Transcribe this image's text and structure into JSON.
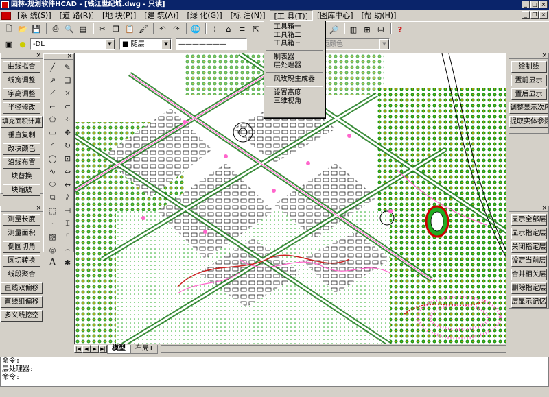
{
  "window": {
    "title": "园林-规划软件HCAD - [钱江世纪城.dwg - 只读]"
  },
  "menu": [
    {
      "label": "[系 统(S)]"
    },
    {
      "label": "[道 路(R)]"
    },
    {
      "label": "[地 块(P)]"
    },
    {
      "label": "[建 筑(A)]"
    },
    {
      "label": "[绿 化(G)]"
    },
    {
      "label": "[标 注(N)]"
    },
    {
      "label": "[工 具(T)]"
    },
    {
      "label": "[图库中心]"
    },
    {
      "label": "[帮 助(H)]"
    }
  ],
  "active_menu_index": 6,
  "dropdown": {
    "group1": [
      "工具箱一",
      "工具箱二",
      "工具箱三"
    ],
    "group2": [
      "制表器",
      "层处理器"
    ],
    "group3": [
      "风玫瑰生成器"
    ],
    "group4": [
      "设置高度",
      "三维视角"
    ]
  },
  "toolbar1": {
    "icons": [
      "new-icon",
      "open-icon",
      "save-icon",
      "print-icon",
      "print-preview-icon",
      "cut-icon",
      "copy-icon",
      "paste-icon",
      "match-prop-icon",
      "undo-icon",
      "redo-icon",
      "web-icon",
      "snap-icon",
      "ucs-icon",
      "layer-icon",
      "pick-icon",
      "grid-icon"
    ],
    "right_icons": [
      "zoom-window-icon",
      "properties-icon",
      "table-icon",
      "database-icon",
      "help-icon"
    ]
  },
  "toolbar2": {
    "layer_value": "-DL",
    "color_value": "■ 随层",
    "linetype_value": "——————— CONTINUOUS",
    "plotstyle_value": "随颜色"
  },
  "left_panel_top": {
    "buttons": [
      "曲线拟合",
      "线宽调整",
      "字高调整",
      "半径修改",
      "填充面积计算",
      "垂直复制",
      "改块颜色",
      "沿线布置",
      "块替换",
      "块缩放"
    ]
  },
  "left_panel_bottom": {
    "buttons": [
      "测量长度",
      "测量面积",
      "倒圆切角",
      "圆切转换",
      "线段聚合",
      "直线双偏移",
      "直线组偏移",
      "多义线挖空"
    ]
  },
  "right_panel_top": {
    "buttons": [
      "绘制线",
      "置前显示",
      "置后显示",
      "调整显示次序",
      "提取实体参数"
    ]
  },
  "right_panel_bottom": {
    "buttons": [
      "显示全部层",
      "显示指定层",
      "关闭指定层",
      "设定当前层",
      "合并相关层",
      "删除指定层",
      "层显示记忆"
    ]
  },
  "tabs": [
    "模型",
    "布局1"
  ],
  "command_lines": [
    "命令:",
    "层处理器:",
    "命令:"
  ],
  "colors": {
    "titlebar": "#0a246a",
    "canvas_bg": "#ffffff",
    "road_pink": "#ff66cc",
    "green": "#22aa22"
  }
}
